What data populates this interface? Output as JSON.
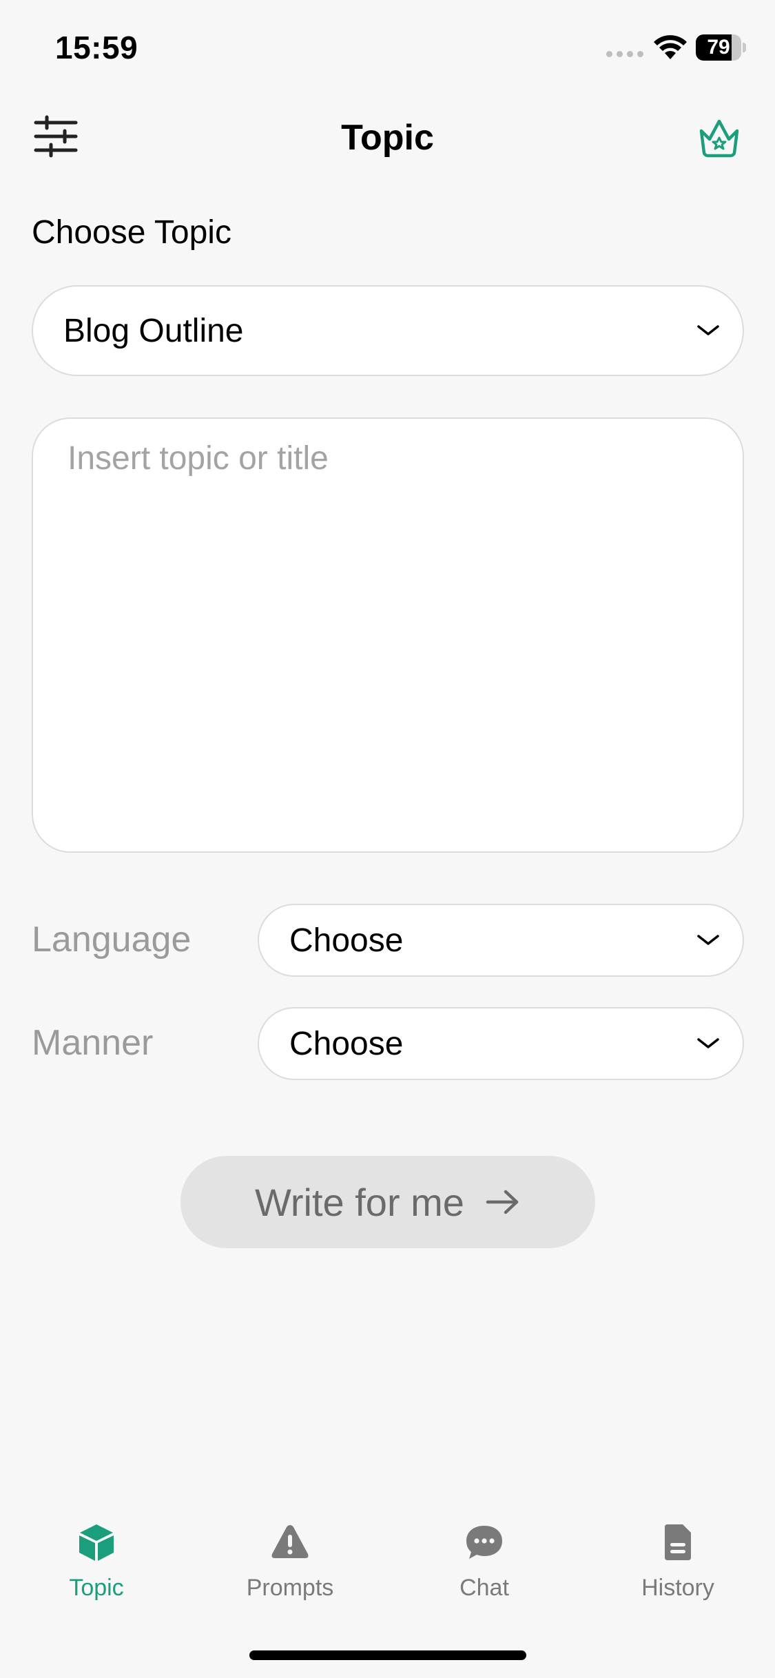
{
  "status_bar": {
    "time": "15:59",
    "battery_level": "79",
    "battery_fraction": 0.79
  },
  "nav": {
    "title": "Topic",
    "left_icon": "sliders-icon",
    "right_icon": "crown-icon"
  },
  "main": {
    "section_title": "Choose Topic",
    "topic_select": {
      "value": "Blog Outline"
    },
    "topic_input": {
      "value": "",
      "placeholder": "Insert topic or title"
    },
    "language": {
      "label": "Language",
      "value": "Choose"
    },
    "manner": {
      "label": "Manner",
      "value": "Choose"
    },
    "write_button": {
      "label": "Write for me"
    }
  },
  "tab_bar": {
    "items": [
      {
        "label": "Topic",
        "icon": "cube-icon",
        "active": true
      },
      {
        "label": "Prompts",
        "icon": "warning-icon",
        "active": false
      },
      {
        "label": "Chat",
        "icon": "chat-bubble-icon",
        "active": false
      },
      {
        "label": "History",
        "icon": "document-icon",
        "active": false
      }
    ]
  },
  "colors": {
    "accent": "#1a9e7c",
    "background": "#f7f7f7",
    "border": "#dcdcdc",
    "inactive": "#7a7a7a"
  }
}
